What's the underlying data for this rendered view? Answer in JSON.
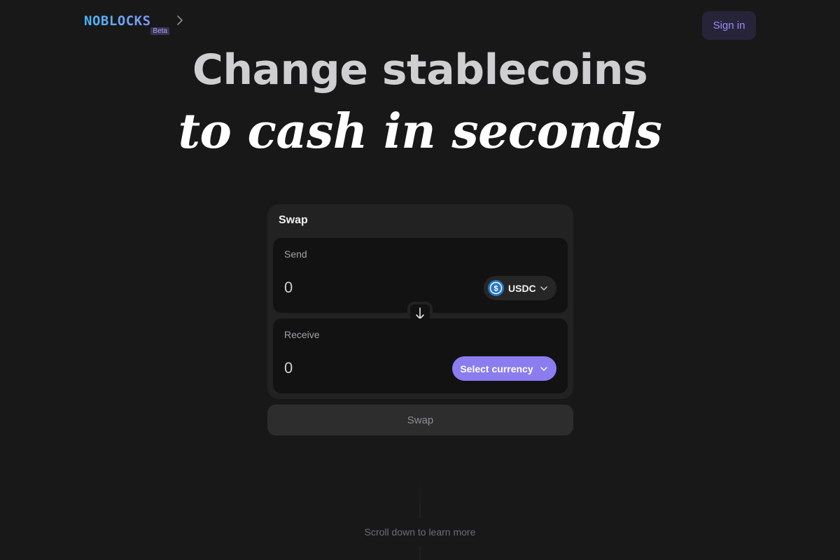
{
  "header": {
    "logo_text": "NOBLOCKS",
    "beta_label": "Beta",
    "sign_in_label": "Sign in"
  },
  "hero": {
    "line1": "Change stablecoins",
    "line2": "to cash in seconds"
  },
  "swap_card": {
    "title": "Swap",
    "send": {
      "label": "Send",
      "amount": "0",
      "token": "USDC",
      "token_icon": "usdc-icon"
    },
    "receive": {
      "label": "Receive",
      "amount": "0",
      "currency_placeholder": "Select currency"
    },
    "swap_direction_icon": "arrow-down-icon",
    "submit_label": "Swap"
  },
  "footer": {
    "scroll_hint": "Scroll down to learn more"
  },
  "colors": {
    "background": "#181819",
    "accent": "#8b7cf0",
    "usdc_blue": "#2775ca"
  }
}
